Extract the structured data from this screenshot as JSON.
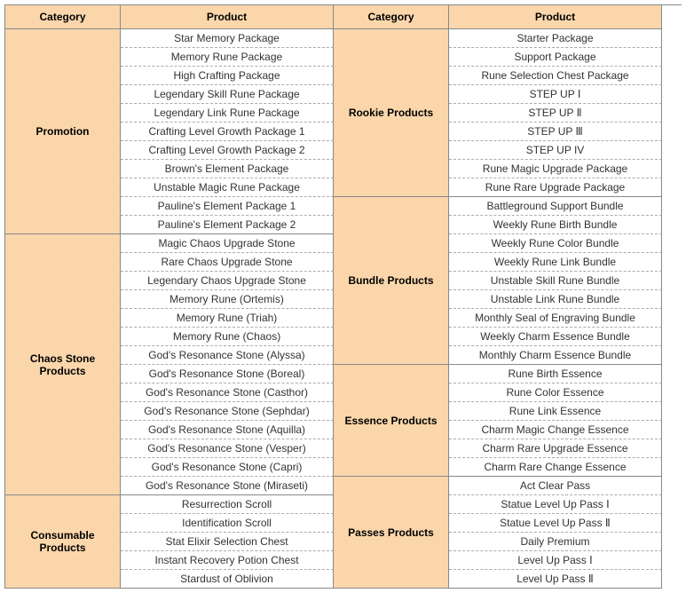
{
  "headers": {
    "col1": "Category",
    "col2": "Product",
    "col3": "Category",
    "col4": "Product"
  },
  "left": {
    "promotion": {
      "label": "Promotion",
      "items": [
        "Star Memory Package",
        "Memory Rune Package",
        "High Crafting Package",
        "Legendary Skill Rune Package",
        "Legendary Link Rune Package",
        "Crafting Level Growth Package 1",
        "Crafting Level Growth Package 2",
        "Brown's Element Package",
        "Unstable Magic Rune Package",
        "Pauline's Element Package 1",
        "Pauline's Element Package 2"
      ]
    },
    "chaos": {
      "label": "Chaos Stone Products",
      "items": [
        "Magic Chaos Upgrade Stone",
        "Rare Chaos Upgrade Stone",
        "Legendary Chaos Upgrade Stone",
        "Memory Rune (Ortemis)",
        "Memory Rune (Triah)",
        "Memory Rune (Chaos)",
        "God's Resonance Stone (Alyssa)",
        "God's Resonance Stone (Boreal)",
        "God's Resonance Stone (Casthor)",
        "God's Resonance Stone (Sephdar)",
        "God's Resonance Stone (Aquilla)",
        "God's Resonance Stone (Vesper)",
        "God's Resonance Stone (Capri)",
        "God's Resonance Stone (Miraseti)"
      ]
    },
    "consumable": {
      "label": "Consumable Products",
      "items": [
        "Resurrection Scroll",
        "Identification Scroll",
        "Stat Elixir Selection Chest",
        "Instant Recovery Potion Chest",
        "Stardust of Oblivion"
      ]
    }
  },
  "right": {
    "rookie": {
      "label": "Rookie Products",
      "items": [
        "Starter Package",
        "Support Package",
        "Rune Selection Chest Package",
        "STEP UP Ⅰ",
        "STEP UP Ⅱ",
        "STEP UP Ⅲ",
        "STEP UP IV",
        "Rune Magic Upgrade Package",
        "Rune Rare Upgrade Package"
      ]
    },
    "bundle": {
      "label": "Bundle Products",
      "items": [
        "Battleground Support Bundle",
        "Weekly Rune Birth Bundle",
        "Weekly Rune Color Bundle",
        "Weekly Rune Link Bundle",
        "Unstable Skill Rune Bundle",
        "Unstable Link Rune Bundle",
        "Monthly Seal of Engraving Bundle",
        "Weekly Charm Essence Bundle",
        "Monthly Charm Essence Bundle"
      ]
    },
    "essence": {
      "label": "Essence Products",
      "items": [
        "Rune Birth Essence",
        "Rune Color Essence",
        "Rune Link Essence",
        "Charm Magic Change Essence",
        "Charm Rare Upgrade Essence",
        "Charm Rare Change Essence"
      ]
    },
    "passes": {
      "label": "Passes Products",
      "items": [
        "Act Clear Pass",
        "Statue Level Up Pass Ⅰ",
        "Statue Level Up Pass Ⅱ",
        "Daily Premium",
        "Level Up Pass Ⅰ",
        "Level Up Pass Ⅱ"
      ]
    }
  }
}
